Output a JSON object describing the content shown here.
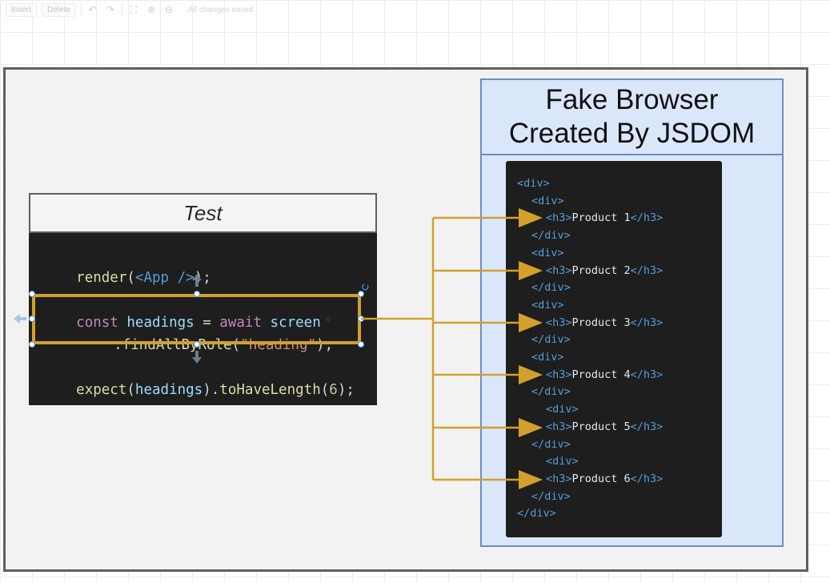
{
  "toolbar": {
    "insert_label": "Insert",
    "delete_label": "Delete",
    "status": "All changes saved"
  },
  "test_panel": {
    "title": "Test",
    "line1": {
      "fn": "render",
      "open": "(",
      "tag": "<App />",
      "close": ");"
    },
    "line2": {
      "kw1": "const",
      "var": "headings",
      "eq": " = ",
      "kw2": "await",
      "obj": "screen"
    },
    "line3": {
      "dot": ".",
      "fn": "findAllByRole",
      "open": "(",
      "str": "\"heading\"",
      "close": ");"
    },
    "line4": {
      "fn": "expect",
      "open": "(",
      "var": "headings",
      "mid": ").",
      "fn2": "toHaveLength",
      "open2": "(",
      "num": "6",
      "close": ");"
    }
  },
  "browser": {
    "title_line1": "Fake Browser",
    "title_line2": "Created By JSDOM"
  },
  "dom": {
    "div_open": "<div>",
    "div_close": "</div>",
    "h3_open": "<h3>",
    "h3_close": "</h3>",
    "products": [
      "Product 1",
      "Product 2",
      "Product 3",
      "Product 4",
      "Product 5",
      "Product 6"
    ]
  },
  "colors": {
    "arrow": "#d4a02c",
    "browser_fill": "#dae7fb",
    "browser_border": "#6c8ebf",
    "code_bg": "#1e1e1e",
    "selection": "#4a90d9"
  }
}
